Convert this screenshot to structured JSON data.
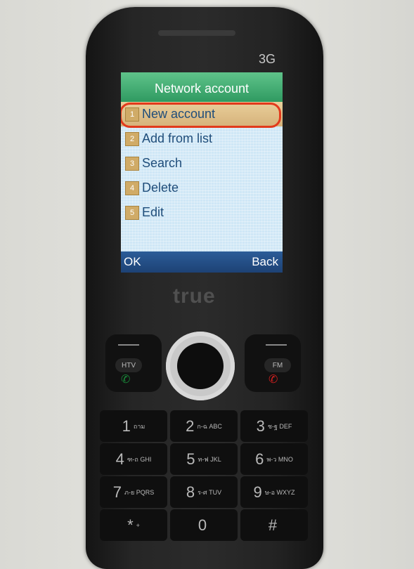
{
  "device": {
    "network_badge": "3G",
    "brand": "true"
  },
  "screen": {
    "title": "Network account",
    "menu": [
      {
        "number": "1",
        "label": "New account",
        "selected": true
      },
      {
        "number": "2",
        "label": "Add from list",
        "selected": false
      },
      {
        "number": "3",
        "label": "Search",
        "selected": false
      },
      {
        "number": "4",
        "label": "Delete",
        "selected": false
      },
      {
        "number": "5",
        "label": "Edit",
        "selected": false
      }
    ],
    "softkeys": {
      "left": "OK",
      "right": "Back"
    }
  },
  "side_keys": {
    "left_label": "HTV",
    "right_label": "FM"
  },
  "keypad": [
    [
      {
        "digit": "1",
        "sub": "ถาม"
      },
      {
        "digit": "2",
        "sub": "ก-ฉ ABC"
      },
      {
        "digit": "3",
        "sub": "ช-ฐ DEF"
      }
    ],
    [
      {
        "digit": "4",
        "sub": "ฑ-ถ GHI"
      },
      {
        "digit": "5",
        "sub": "ท-ฟ JKL"
      },
      {
        "digit": "6",
        "sub": "พ-ว MNO"
      }
    ],
    [
      {
        "digit": "7",
        "sub": "ภ-ย PQRS"
      },
      {
        "digit": "8",
        "sub": "ร-ศ TUV"
      },
      {
        "digit": "9",
        "sub": "ษ-อ WXYZ"
      }
    ],
    [
      {
        "digit": "*",
        "sub": "+"
      },
      {
        "digit": "0",
        "sub": ""
      },
      {
        "digit": "#",
        "sub": ""
      }
    ]
  ],
  "colors": {
    "title_bar": "#3faf73",
    "softbar": "#1d4275",
    "selection_highlight": "#e23a1c",
    "menu_text": "#1f4d7a"
  }
}
